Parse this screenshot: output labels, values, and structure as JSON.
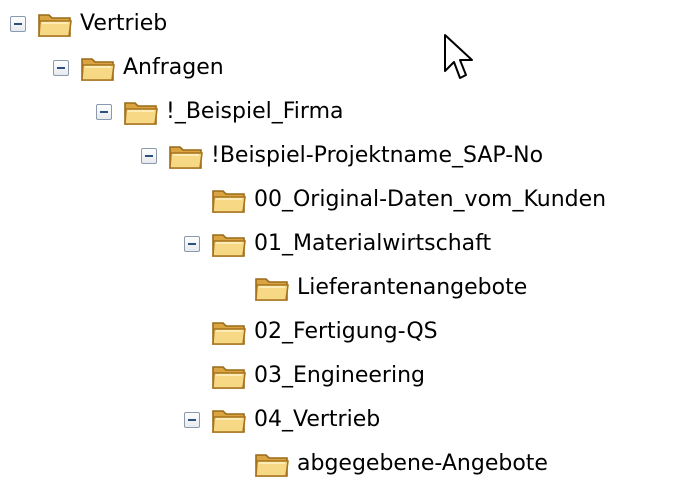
{
  "tree": {
    "nodes": [
      {
        "label": "Vertrieb",
        "expanded": true
      },
      {
        "label": "Anfragen",
        "expanded": true
      },
      {
        "label": "!_Beispiel_Firma",
        "expanded": true
      },
      {
        "label": "!Beispiel-Projektname_SAP-No",
        "expanded": true
      },
      {
        "label": "00_Original-Daten_vom_Kunden",
        "expanded": false
      },
      {
        "label": "01_Materialwirtschaft",
        "expanded": true
      },
      {
        "label": "Lieferantenangebote",
        "expanded": false
      },
      {
        "label": "02_Fertigung-QS",
        "expanded": false
      },
      {
        "label": "03_Engineering",
        "expanded": false
      },
      {
        "label": "04_Vertrieb",
        "expanded": true
      },
      {
        "label": "abgegebene-Angebote",
        "expanded": false
      }
    ]
  },
  "icons": {
    "toggle": "collapse-minus-icon",
    "folder": "folder-icon",
    "cursor": "mouse-pointer-icon"
  },
  "colors": {
    "folder_fill": "#f3d37a",
    "folder_dark": "#b8862a",
    "toggle_border": "#8a9bb0",
    "toggle_minus": "#2d4f7e"
  }
}
